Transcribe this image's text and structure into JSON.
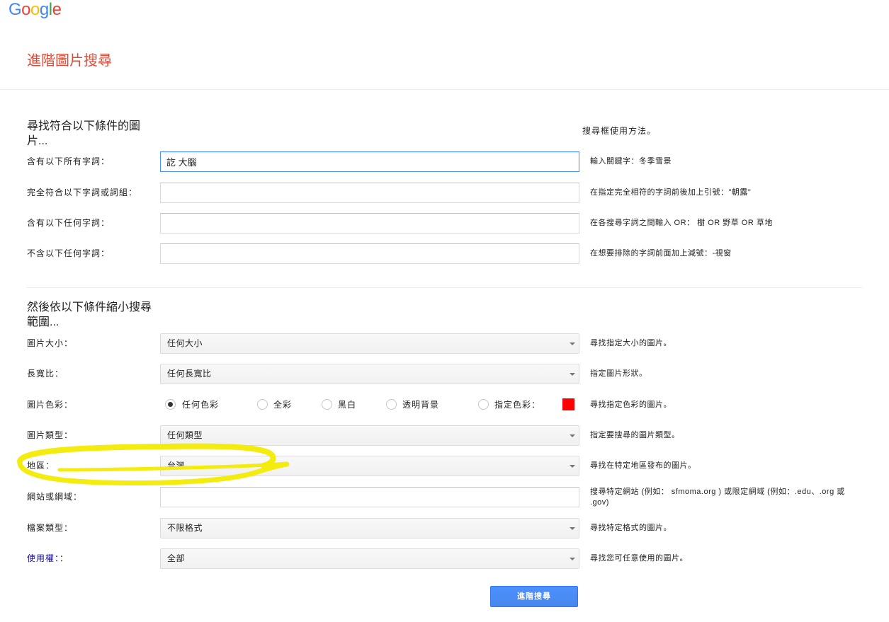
{
  "logo": {
    "letters": [
      "G",
      "o",
      "o",
      "g",
      "l",
      "e"
    ],
    "colors": [
      "#4285f4",
      "#ea4335",
      "#fbbc05",
      "#4285f4",
      "#34a853",
      "#ea4335"
    ]
  },
  "page_title": "進階圖片搜尋",
  "help_link": "搜尋框使用方法。",
  "section1": {
    "heading": "尋找符合以下條件的圖片...",
    "rows": [
      {
        "label": "含有以下所有字詞：",
        "value": "訖 大腦",
        "hint": "輸入關鍵字：冬季雪景"
      },
      {
        "label": "完全符合以下字詞或詞組：",
        "value": "",
        "hint": "在指定完全相符的字詞前後加上引號：\"朝露\""
      },
      {
        "label": "含有以下任何字詞：",
        "value": "",
        "hint": "在各搜尋字詞之間輸入 OR： 樹 OR 野草 OR 草地"
      },
      {
        "label": "不含以下任何字詞：",
        "value": "",
        "hint": "在想要排除的字詞前面加上減號：-視窗"
      }
    ]
  },
  "section2": {
    "heading": "然後依以下條件縮小搜尋範圍...",
    "image_size": {
      "label": "圖片大小：",
      "selected": "任何大小",
      "hint": "尋找指定大小的圖片。"
    },
    "aspect_ratio": {
      "label": "長寬比：",
      "selected": "任何長寬比",
      "hint": "指定圖片形狀。"
    },
    "color": {
      "label": "圖片色彩：",
      "options": [
        "任何色彩",
        "全彩",
        "黑白",
        "透明背景",
        "指定色彩："
      ],
      "selected": "任何色彩",
      "swatch_color": "#ff0000",
      "hint": "尋找指定色彩的圖片。"
    },
    "type": {
      "label": "圖片類型：",
      "selected": "任何類型",
      "hint": "指定要搜尋的圖片類型。"
    },
    "region": {
      "label": "地區：",
      "selected": "台灣",
      "hint": "尋找在特定地區發布的圖片。"
    },
    "site": {
      "label": "網站或網域：",
      "value": "",
      "hint": "搜尋特定網站 (例如： sfmoma.org ) 或限定網域 (例如：.edu、.org 或 .gov)"
    },
    "file_type": {
      "label": "檔案類型：",
      "selected": "不限格式",
      "hint": "尋找特定格式的圖片。"
    },
    "usage_rights": {
      "link": "使用權：",
      "suffix": "：",
      "selected": "全部",
      "hint": "尋找您可任意使用的圖片。"
    }
  },
  "submit_label": "進階搜尋",
  "colors": {
    "title": "#dd4b39",
    "link": "#1a0dab",
    "help_link": "#222222",
    "accent": "#4d90fe",
    "highlight": "#f4eb0f"
  }
}
